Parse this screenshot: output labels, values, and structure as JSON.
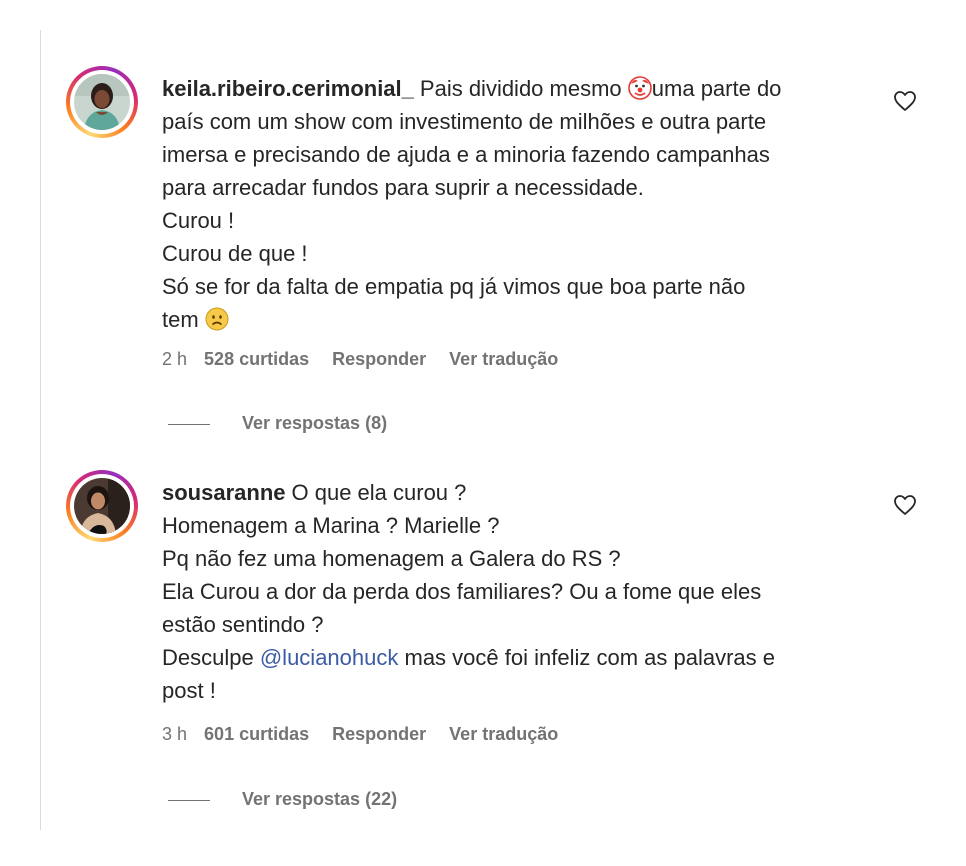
{
  "comments": [
    {
      "username": "keila.ribeiro.cerimonial_",
      "lines": [
        "Pais dividido mesmo",
        "uma parte do",
        "país com um show com investimento de milhões e outra parte",
        "imersa e precisando de ajuda e a minoria fazendo campanhas",
        "para arrecadar fundos para suprir a necessidade.",
        "Curou !",
        "Curou de que !",
        "Só se for da falta de empatia pq já vimos que boa parte não",
        "tem"
      ],
      "emojis": [
        "clown-face",
        "sad-face"
      ],
      "time": "2 h",
      "likes": "528 curtidas",
      "reply_label": "Responder",
      "translate_label": "Ver tradução",
      "view_replies": "Ver respostas (8)"
    },
    {
      "username": "sousaranne",
      "lines": [
        "O que ela curou ?",
        "Homenagem a Marina ? Marielle ?",
        "Pq não fez uma homenagem a Galera do RS ?",
        "Ela Curou a dor da perda dos familiares? Ou a fome que eles",
        "estão sentindo ?",
        "Desculpe",
        "@lucianohuck",
        "mas você foi infeliz com as palavras e",
        "post !"
      ],
      "time": "3 h",
      "likes": "601 curtidas",
      "reply_label": "Responder",
      "translate_label": "Ver tradução",
      "view_replies": "Ver respostas (22)"
    }
  ],
  "colors": {
    "text": "#262626",
    "muted": "#737373",
    "mention": "#3b5ba5",
    "divider": "#dbdbdb"
  }
}
